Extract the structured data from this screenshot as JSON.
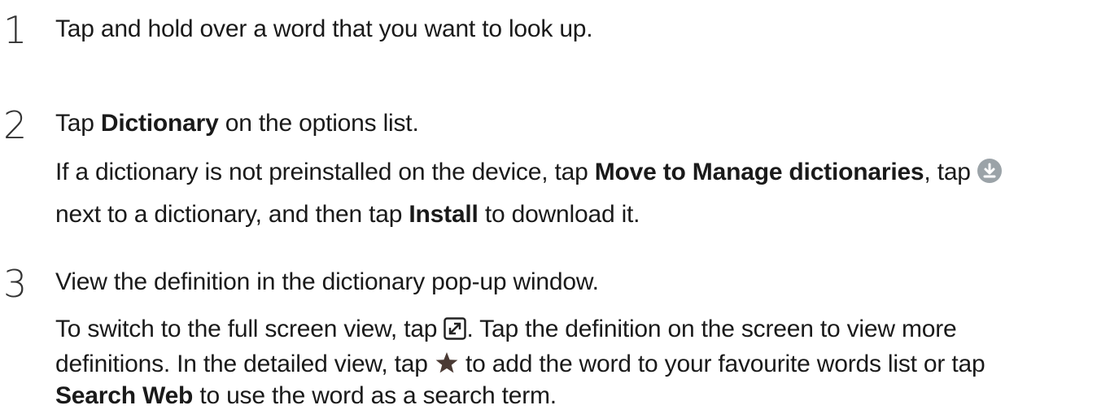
{
  "steps": [
    {
      "number": "1",
      "main": "Tap and hold over a word that you want to look up."
    },
    {
      "number": "2",
      "main_pre": "Tap ",
      "main_bold": "Dictionary",
      "main_post": " on the options list.",
      "detail1_pre": "If a dictionary is not preinstalled on the device, tap ",
      "detail1_bold": "Move to Manage dictionaries",
      "detail1_post": ", tap ",
      "detail2_pre": "next to a dictionary, and then tap ",
      "detail2_bold": "Install",
      "detail2_post": " to download it."
    },
    {
      "number": "3",
      "main": "View the definition in the dictionary pop-up window.",
      "detail1_pre": "To switch to the full screen view, tap ",
      "detail1_post": ". Tap the definition on the screen to view more",
      "detail2_pre": "definitions. In the detailed view, tap ",
      "detail2_post": " to add the word to your favourite words list or tap",
      "detail3_bold": "Search Web",
      "detail3_post": " to use the word as a search term."
    }
  ],
  "icons": {
    "download": "download-icon",
    "expand": "expand-icon",
    "star": "star-icon"
  },
  "colors": {
    "download_icon_bg": "#9ba3a8",
    "star": "#4a3a34",
    "text": "#1a1a1a"
  }
}
